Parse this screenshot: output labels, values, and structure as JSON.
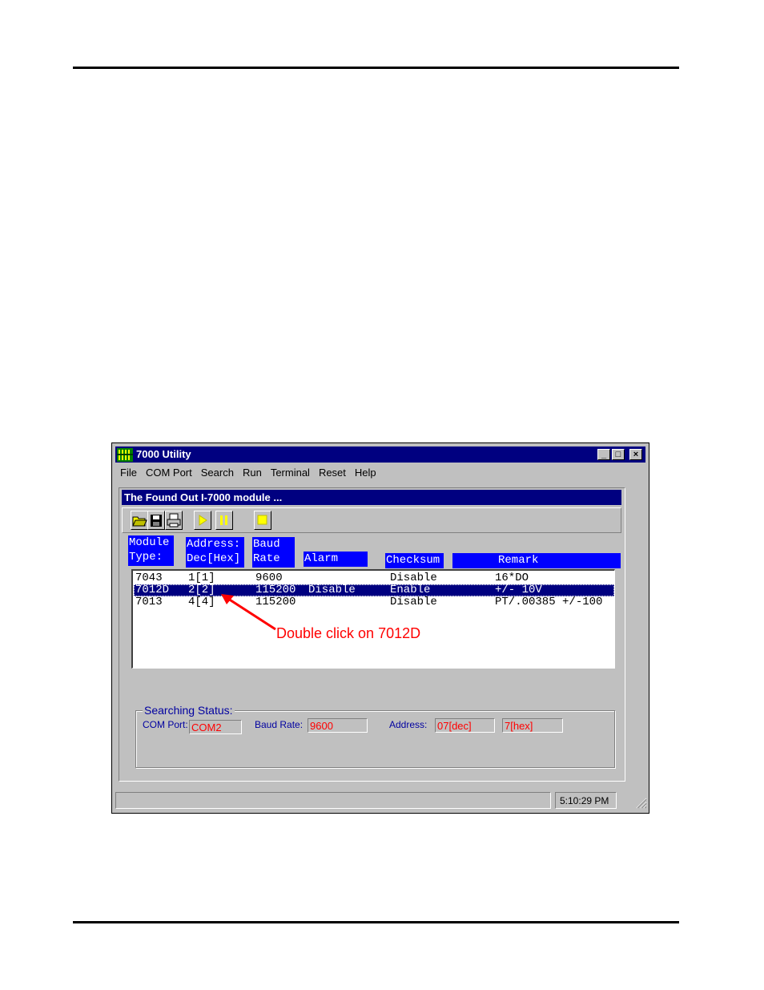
{
  "window": {
    "title": "7000 Utility",
    "minimize": "_",
    "maximize": "□",
    "close": "×"
  },
  "menu": [
    "File",
    "COM Port",
    "Search",
    "Run",
    "Terminal",
    "Reset",
    "Help"
  ],
  "child_window": {
    "title": "The Found Out I-7000 module ..."
  },
  "toolbar": {
    "buttons": [
      "open-folder-icon",
      "save-disk-icon",
      "print-icon",
      "play-icon",
      "pause-icon",
      "stop-icon"
    ]
  },
  "headers": {
    "module_type": "Module\nType:",
    "address": "Address:\nDec[Hex]",
    "baud_rate": "Baud\nRate",
    "alarm": "Alarm",
    "checksum": "Checksum",
    "remark": "Remark"
  },
  "rows": [
    {
      "module": "7043",
      "address": "1[1]",
      "baud": "9600",
      "alarm": "",
      "checksum": "Disable",
      "remark": "16*DO",
      "selected": false
    },
    {
      "module": "7012D",
      "address": "2[2]",
      "baud": "115200",
      "alarm": "Disable",
      "checksum": "Enable",
      "remark": "+/- 10V",
      "selected": true
    },
    {
      "module": "7013",
      "address": "4[4]",
      "baud": "115200",
      "alarm": "",
      "checksum": "Disable",
      "remark": "PT/.00385 +/-100",
      "selected": false
    }
  ],
  "annotation": "Double click on 7012D",
  "searching_status": {
    "legend": "Searching Status:",
    "com_port_label": "COM Port:",
    "com_port_value": "COM2",
    "baud_rate_label": "Baud Rate:",
    "baud_rate_value": "9600",
    "address_label": "Address:",
    "address_dec": "07[dec]",
    "address_hex": "7[hex]"
  },
  "statusbar": {
    "time": "5:10:29 PM"
  },
  "colors": {
    "title_bar": "#000080",
    "header_bg": "#0000ff",
    "annotation": "#ff0000",
    "face": "#c0c0c0"
  }
}
